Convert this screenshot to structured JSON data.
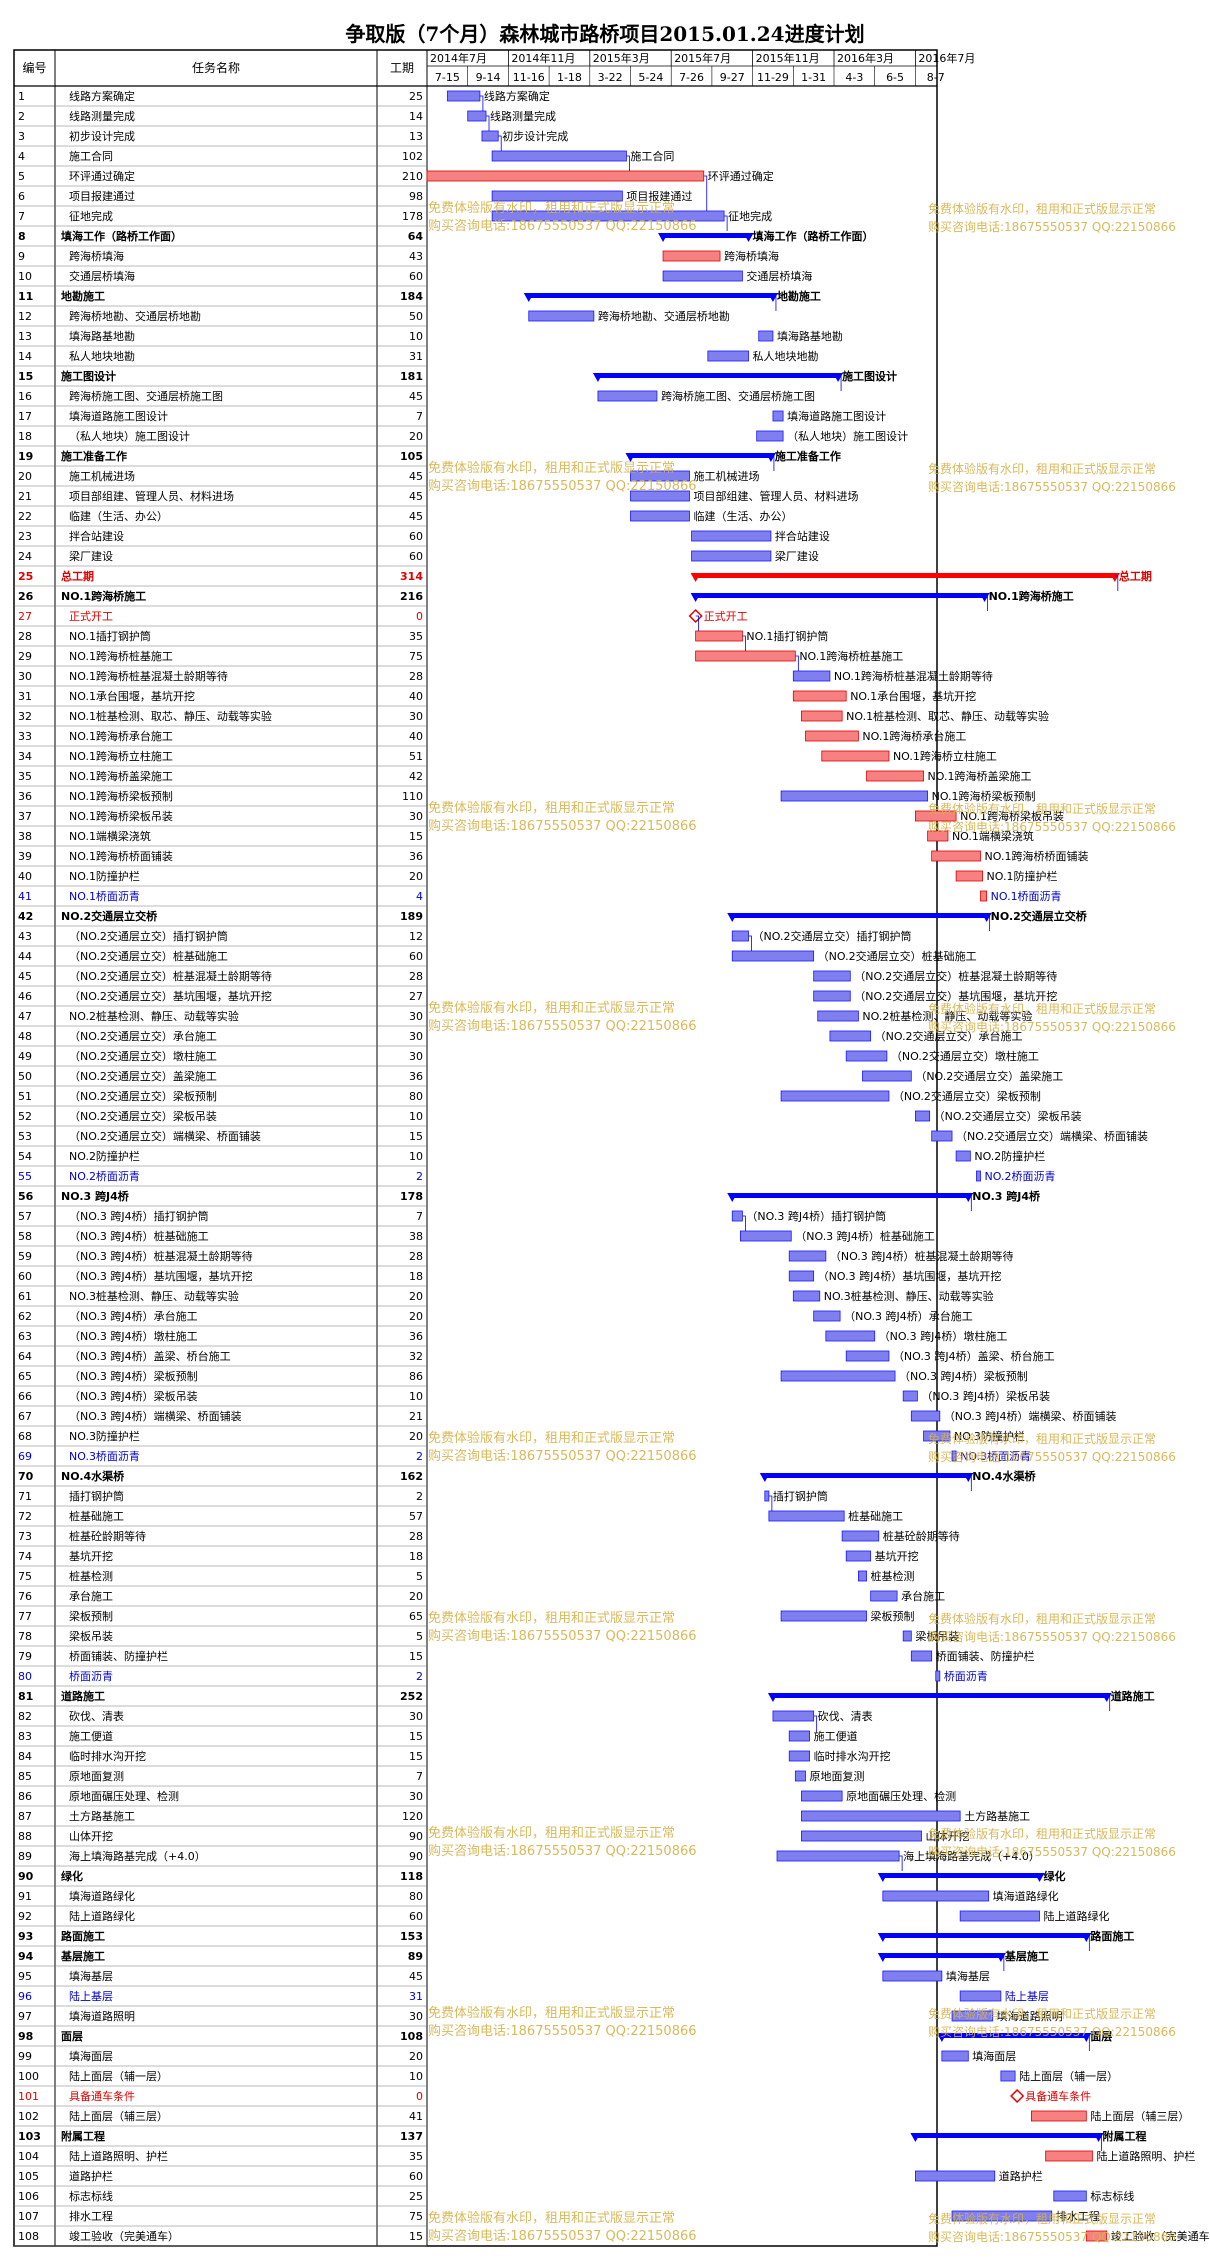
{
  "title": "争取版（7个月）森林城市路桥项目2015.01.24进度计划",
  "headers": {
    "id": "编号",
    "name": "任务名称",
    "days": "工期"
  },
  "timeline_top": [
    "2014年7月",
    "2014年11月",
    "2015年3月",
    "2015年7月",
    "2015年11月",
    "2016年3月",
    "2016年7月"
  ],
  "timeline_bottom": [
    "7-15",
    "9-14",
    "11-16",
    "1-18",
    "3-22",
    "5-24",
    "7-26",
    "9-27",
    "11-29",
    "1-31",
    "4-3",
    "6-5",
    "8-7"
  ],
  "watermark": {
    "line1": "免费体验版有水印，租用和正式版显示正常",
    "line2": "购买咨询电话:18675550537 QQ:22150866"
  },
  "tasks": [
    {
      "id": "1",
      "name": "线路方案确定",
      "days": 25,
      "t": "n",
      "s": 0.5,
      "e": 1.3
    },
    {
      "id": "2",
      "name": "线路测量完成",
      "days": 14,
      "t": "n",
      "s": 1.0,
      "e": 1.45
    },
    {
      "id": "3",
      "name": "初步设计完成",
      "days": 13,
      "t": "n",
      "s": 1.35,
      "e": 1.75
    },
    {
      "id": "4",
      "name": "施工合同",
      "days": 102,
      "t": "n",
      "s": 1.6,
      "e": 4.9
    },
    {
      "id": "5",
      "name": "环评通过确定",
      "days": 210,
      "t": "r",
      "s": 0.0,
      "e": 6.8
    },
    {
      "id": "6",
      "name": "项目报建通过",
      "days": 98,
      "t": "n",
      "s": 1.6,
      "e": 4.8
    },
    {
      "id": "7",
      "name": "征地完成",
      "days": 178,
      "t": "n",
      "s": 1.6,
      "e": 7.3
    },
    {
      "id": "8",
      "name": "填海工作（路桥工作面）",
      "days": 64,
      "t": "s",
      "s": 5.8,
      "e": 7.9
    },
    {
      "id": "9",
      "name": "跨海桥填海",
      "days": 43,
      "t": "r",
      "s": 5.8,
      "e": 7.2
    },
    {
      "id": "10",
      "name": "交通层桥填海",
      "days": 60,
      "t": "n",
      "s": 5.8,
      "e": 7.75
    },
    {
      "id": "11",
      "name": "地勘施工",
      "days": 184,
      "t": "s",
      "s": 2.5,
      "e": 8.5
    },
    {
      "id": "12",
      "name": "跨海桥地勘、交通层桥地勘",
      "days": 50,
      "t": "n",
      "s": 2.5,
      "e": 4.1
    },
    {
      "id": "13",
      "name": "填海路基地勘",
      "days": 10,
      "t": "n",
      "s": 8.15,
      "e": 8.5
    },
    {
      "id": "14",
      "name": "私人地块地勘",
      "days": 31,
      "t": "n",
      "s": 6.9,
      "e": 7.9
    },
    {
      "id": "15",
      "name": "施工图设计",
      "days": 181,
      "t": "s",
      "s": 4.2,
      "e": 10.1
    },
    {
      "id": "16",
      "name": "跨海桥施工图、交通层桥施工图",
      "days": 45,
      "t": "n",
      "s": 4.2,
      "e": 5.65
    },
    {
      "id": "17",
      "name": "填海道路施工图设计",
      "days": 7,
      "t": "n",
      "s": 8.5,
      "e": 8.75
    },
    {
      "id": "18",
      "name": "（私人地块）施工图设计",
      "days": 20,
      "t": "n",
      "s": 8.1,
      "e": 8.75
    },
    {
      "id": "19",
      "name": "施工准备工作",
      "days": 105,
      "t": "s",
      "s": 5.0,
      "e": 8.45
    },
    {
      "id": "20",
      "name": "施工机械进场",
      "days": 45,
      "t": "n",
      "s": 5.0,
      "e": 6.45
    },
    {
      "id": "21",
      "name": "项目部组建、管理人员、材料进场",
      "days": 45,
      "t": "n",
      "s": 5.0,
      "e": 6.45
    },
    {
      "id": "22",
      "name": "临建（生活、办公）",
      "days": 45,
      "t": "n",
      "s": 5.0,
      "e": 6.45
    },
    {
      "id": "23",
      "name": "拌合站建设",
      "days": 60,
      "t": "n",
      "s": 6.5,
      "e": 8.45
    },
    {
      "id": "24",
      "name": "梁厂建设",
      "days": 60,
      "t": "n",
      "s": 6.5,
      "e": 8.45
    },
    {
      "id": "25",
      "name": "总工期",
      "days": 314,
      "t": "rs",
      "s": 6.6,
      "e": 16.9
    },
    {
      "id": "26",
      "name": "NO.1跨海桥施工",
      "days": 216,
      "t": "s",
      "s": 6.6,
      "e": 13.7
    },
    {
      "id": "27",
      "name": "正式开工",
      "days": 0,
      "t": "rm",
      "s": 6.6,
      "e": 6.6
    },
    {
      "id": "28",
      "name": "NO.1插打钢护筒",
      "days": 35,
      "t": "r",
      "s": 6.6,
      "e": 7.75
    },
    {
      "id": "29",
      "name": "NO.1跨海桥桩基施工",
      "days": 75,
      "t": "r",
      "s": 6.6,
      "e": 9.05
    },
    {
      "id": "30",
      "name": "NO.1跨海桥桩基混凝土龄期等待",
      "days": 28,
      "t": "n",
      "s": 9.0,
      "e": 9.9
    },
    {
      "id": "31",
      "name": "NO.1承台围堰，基坑开挖",
      "days": 40,
      "t": "r",
      "s": 9.0,
      "e": 10.3
    },
    {
      "id": "32",
      "name": "NO.1桩基检测、取芯、静压、动载等实验",
      "days": 30,
      "t": "r",
      "s": 9.2,
      "e": 10.2
    },
    {
      "id": "33",
      "name": "NO.1跨海桥承台施工",
      "days": 40,
      "t": "r",
      "s": 9.3,
      "e": 10.6
    },
    {
      "id": "34",
      "name": "NO.1跨海桥立柱施工",
      "days": 51,
      "t": "r",
      "s": 9.7,
      "e": 11.35
    },
    {
      "id": "35",
      "name": "NO.1跨海桥盖梁施工",
      "days": 42,
      "t": "r",
      "s": 10.8,
      "e": 12.2
    },
    {
      "id": "36",
      "name": "NO.1跨海桥梁板预制",
      "days": 110,
      "t": "n",
      "s": 8.7,
      "e": 12.3
    },
    {
      "id": "37",
      "name": "NO.1跨海桥梁板吊装",
      "days": 30,
      "t": "r",
      "s": 12.0,
      "e": 13.0
    },
    {
      "id": "38",
      "name": "NO.1端横梁浇筑",
      "days": 15,
      "t": "r",
      "s": 12.3,
      "e": 12.8
    },
    {
      "id": "39",
      "name": "NO.1跨海桥桥面铺装",
      "days": 36,
      "t": "r",
      "s": 12.4,
      "e": 13.6
    },
    {
      "id": "40",
      "name": "NO.1防撞护栏",
      "days": 20,
      "t": "r",
      "s": 13.0,
      "e": 13.65
    },
    {
      "id": "41",
      "name": "NO.1桥面沥青",
      "days": 4,
      "t": "r",
      "s": 13.6,
      "e": 13.75
    },
    {
      "id": "42",
      "name": "NO.2交通层立交桥",
      "days": 189,
      "t": "s",
      "s": 7.5,
      "e": 13.75
    },
    {
      "id": "43",
      "name": "（NO.2交通层立交）插打钢护筒",
      "days": 12,
      "t": "n",
      "s": 7.5,
      "e": 7.9
    },
    {
      "id": "44",
      "name": "（NO.2交通层立交）桩基础施工",
      "days": 60,
      "t": "n",
      "s": 7.5,
      "e": 9.5
    },
    {
      "id": "45",
      "name": "（NO.2交通层立交）桩基混凝土龄期等待",
      "days": 28,
      "t": "n",
      "s": 9.5,
      "e": 10.4
    },
    {
      "id": "46",
      "name": "（NO.2交通层立交）基坑围堰，基坑开挖",
      "days": 27,
      "t": "n",
      "s": 9.5,
      "e": 10.4
    },
    {
      "id": "47",
      "name": "NO.2桩基检测、静压、动载等实验",
      "days": 30,
      "t": "n",
      "s": 9.6,
      "e": 10.6
    },
    {
      "id": "48",
      "name": "（NO.2交通层立交）承台施工",
      "days": 30,
      "t": "n",
      "s": 9.9,
      "e": 10.9
    },
    {
      "id": "49",
      "name": "（NO.2交通层立交）墩柱施工",
      "days": 30,
      "t": "n",
      "s": 10.3,
      "e": 11.3
    },
    {
      "id": "50",
      "name": "（NO.2交通层立交）盖梁施工",
      "days": 36,
      "t": "n",
      "s": 10.7,
      "e": 11.9
    },
    {
      "id": "51",
      "name": "（NO.2交通层立交）梁板预制",
      "days": 80,
      "t": "n",
      "s": 8.7,
      "e": 11.35
    },
    {
      "id": "52",
      "name": "（NO.2交通层立交）梁板吊装",
      "days": 10,
      "t": "n",
      "s": 12.0,
      "e": 12.35
    },
    {
      "id": "53",
      "name": "（NO.2交通层立交）端横梁、桥面铺装",
      "days": 15,
      "t": "n",
      "s": 12.4,
      "e": 12.9
    },
    {
      "id": "54",
      "name": "NO.2防撞护栏",
      "days": 10,
      "t": "n",
      "s": 13.0,
      "e": 13.35
    },
    {
      "id": "55",
      "name": "NO.2桥面沥青",
      "days": 2,
      "t": "n",
      "s": 13.5,
      "e": 13.6
    },
    {
      "id": "56",
      "name": "NO.3 跨J4桥",
      "days": 178,
      "t": "s",
      "s": 7.5,
      "e": 13.3
    },
    {
      "id": "57",
      "name": "（NO.3 跨J4桥）插打钢护筒",
      "days": 7,
      "t": "n",
      "s": 7.5,
      "e": 7.75
    },
    {
      "id": "58",
      "name": "（NO.3 跨J4桥）桩基础施工",
      "days": 38,
      "t": "n",
      "s": 7.7,
      "e": 8.95
    },
    {
      "id": "59",
      "name": "（NO.3 跨J4桥）桩基混凝土龄期等待",
      "days": 28,
      "t": "n",
      "s": 8.9,
      "e": 9.8
    },
    {
      "id": "60",
      "name": "（NO.3 跨J4桥）基坑围堰，基坑开挖",
      "days": 18,
      "t": "n",
      "s": 8.9,
      "e": 9.5
    },
    {
      "id": "61",
      "name": "NO.3桩基检测、静压、动载等实验",
      "days": 20,
      "t": "n",
      "s": 9.0,
      "e": 9.65
    },
    {
      "id": "62",
      "name": "（NO.3 跨J4桥）承台施工",
      "days": 20,
      "t": "n",
      "s": 9.5,
      "e": 10.15
    },
    {
      "id": "63",
      "name": "（NO.3 跨J4桥）墩柱施工",
      "days": 36,
      "t": "n",
      "s": 9.8,
      "e": 11.0
    },
    {
      "id": "64",
      "name": "（NO.3 跨J4桥）盖梁、桥台施工",
      "days": 32,
      "t": "n",
      "s": 10.3,
      "e": 11.35
    },
    {
      "id": "65",
      "name": "（NO.3 跨J4桥）梁板预制",
      "days": 86,
      "t": "n",
      "s": 8.7,
      "e": 11.5
    },
    {
      "id": "66",
      "name": "（NO.3 跨J4桥）梁板吊装",
      "days": 10,
      "t": "n",
      "s": 11.7,
      "e": 12.05
    },
    {
      "id": "67",
      "name": "（NO.3 跨J4桥）端横梁、桥面铺装",
      "days": 21,
      "t": "n",
      "s": 11.9,
      "e": 12.6
    },
    {
      "id": "68",
      "name": "NO.3防撞护栏",
      "days": 20,
      "t": "n",
      "s": 12.2,
      "e": 12.85
    },
    {
      "id": "69",
      "name": "NO.3桥面沥青",
      "days": 2,
      "t": "n",
      "s": 12.9,
      "e": 13.0
    },
    {
      "id": "70",
      "name": "NO.4水渠桥",
      "days": 162,
      "t": "s",
      "s": 8.3,
      "e": 13.3
    },
    {
      "id": "71",
      "name": "插打钢护筒",
      "days": 2,
      "t": "n",
      "s": 8.3,
      "e": 8.4
    },
    {
      "id": "72",
      "name": "桩基础施工",
      "days": 57,
      "t": "n",
      "s": 8.4,
      "e": 10.25
    },
    {
      "id": "73",
      "name": "桩基砼龄期等待",
      "days": 28,
      "t": "n",
      "s": 10.2,
      "e": 11.1
    },
    {
      "id": "74",
      "name": "基坑开挖",
      "days": 18,
      "t": "n",
      "s": 10.3,
      "e": 10.9
    },
    {
      "id": "75",
      "name": "桩基检测",
      "days": 5,
      "t": "n",
      "s": 10.6,
      "e": 10.8
    },
    {
      "id": "76",
      "name": "承台施工",
      "days": 20,
      "t": "n",
      "s": 10.9,
      "e": 11.55
    },
    {
      "id": "77",
      "name": "梁板预制",
      "days": 65,
      "t": "n",
      "s": 8.7,
      "e": 10.8
    },
    {
      "id": "78",
      "name": "梁板吊装",
      "days": 5,
      "t": "n",
      "s": 11.7,
      "e": 11.9
    },
    {
      "id": "79",
      "name": "桥面铺装、防撞护栏",
      "days": 15,
      "t": "n",
      "s": 11.9,
      "e": 12.4
    },
    {
      "id": "80",
      "name": "桥面沥青",
      "days": 2,
      "t": "n",
      "s": 12.5,
      "e": 12.6
    },
    {
      "id": "81",
      "name": "道路施工",
      "days": 252,
      "t": "s",
      "s": 8.5,
      "e": 16.7
    },
    {
      "id": "82",
      "name": "砍伐、清表",
      "days": 30,
      "t": "n",
      "s": 8.5,
      "e": 9.5
    },
    {
      "id": "83",
      "name": "施工便道",
      "days": 15,
      "t": "n",
      "s": 8.9,
      "e": 9.4
    },
    {
      "id": "84",
      "name": "临时排水沟开挖",
      "days": 15,
      "t": "n",
      "s": 8.9,
      "e": 9.4
    },
    {
      "id": "85",
      "name": "原地面复测",
      "days": 7,
      "t": "n",
      "s": 9.05,
      "e": 9.3
    },
    {
      "id": "86",
      "name": "原地面碾压处理、检测",
      "days": 30,
      "t": "n",
      "s": 9.2,
      "e": 10.2
    },
    {
      "id": "87",
      "name": "土方路基施工",
      "days": 120,
      "t": "n",
      "s": 9.2,
      "e": 13.1
    },
    {
      "id": "88",
      "name": "山体开挖",
      "days": 90,
      "t": "n",
      "s": 9.2,
      "e": 12.15
    },
    {
      "id": "89",
      "name": "海上填海路基完成（+4.0）",
      "days": 90,
      "t": "n",
      "s": 8.6,
      "e": 11.6
    },
    {
      "id": "90",
      "name": "绿化",
      "days": 118,
      "t": "s",
      "s": 11.2,
      "e": 15.05
    },
    {
      "id": "91",
      "name": "填海道路绿化",
      "days": 80,
      "t": "n",
      "s": 11.2,
      "e": 13.8
    },
    {
      "id": "92",
      "name": "陆上道路绿化",
      "days": 60,
      "t": "n",
      "s": 13.1,
      "e": 15.05
    },
    {
      "id": "93",
      "name": "路面施工",
      "days": 153,
      "t": "s",
      "s": 11.2,
      "e": 16.2
    },
    {
      "id": "94",
      "name": "基层施工",
      "days": 89,
      "t": "s",
      "s": 11.2,
      "e": 14.1
    },
    {
      "id": "95",
      "name": "填海基层",
      "days": 45,
      "t": "n",
      "s": 11.2,
      "e": 12.65
    },
    {
      "id": "96",
      "name": "陆上基层",
      "days": 31,
      "t": "n",
      "s": 13.1,
      "e": 14.1
    },
    {
      "id": "97",
      "name": "填海道路照明",
      "days": 30,
      "t": "n",
      "s": 12.9,
      "e": 13.9
    },
    {
      "id": "98",
      "name": "面层",
      "days": 108,
      "t": "s",
      "s": 12.65,
      "e": 16.2
    },
    {
      "id": "99",
      "name": "填海面层",
      "days": 20,
      "t": "n",
      "s": 12.65,
      "e": 13.3
    },
    {
      "id": "100",
      "name": "陆上面层（辅一层）",
      "days": 10,
      "t": "n",
      "s": 14.1,
      "e": 14.45
    },
    {
      "id": "101",
      "name": "具备通车条件",
      "days": 0,
      "t": "rm",
      "s": 14.5,
      "e": 14.5
    },
    {
      "id": "102",
      "name": "陆上面层（辅三层）",
      "days": 41,
      "t": "r",
      "s": 14.85,
      "e": 16.2
    },
    {
      "id": "103",
      "name": "附属工程",
      "days": 137,
      "t": "s",
      "s": 12.0,
      "e": 16.5
    },
    {
      "id": "104",
      "name": "陆上道路照明、护栏",
      "days": 35,
      "t": "r",
      "s": 15.2,
      "e": 16.35
    },
    {
      "id": "105",
      "name": "道路护栏",
      "days": 60,
      "t": "n",
      "s": 12.0,
      "e": 13.95
    },
    {
      "id": "106",
      "name": "标志标线",
      "days": 25,
      "t": "n",
      "s": 15.4,
      "e": 16.2
    },
    {
      "id": "107",
      "name": "排水工程",
      "days": 75,
      "t": "n",
      "s": 12.9,
      "e": 15.35
    },
    {
      "id": "108",
      "name": "竣工验收（完美通车）",
      "days": 15,
      "t": "r",
      "s": 16.2,
      "e": 16.7
    }
  ]
}
